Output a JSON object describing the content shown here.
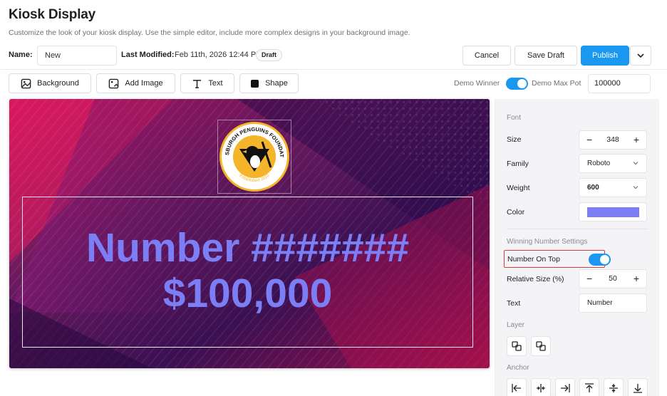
{
  "page": {
    "title": "Kiosk Display",
    "subtitle": "Customize the look of your kiosk display. Use the simple editor, include more complex designs in your background image."
  },
  "meta": {
    "name_label": "Name:",
    "name_value": "New",
    "last_modified_label": "Last Modified:",
    "last_modified_value": "Feb 11th, 2026 12:44 PM",
    "status_badge": "Draft"
  },
  "actions": {
    "cancel": "Cancel",
    "save_draft": "Save Draft",
    "publish": "Publish"
  },
  "toolbar": {
    "background": "Background",
    "add_image": "Add Image",
    "text": "Text",
    "shape": "Shape",
    "demo_winner_label": "Demo Winner",
    "demo_winner_on": true,
    "demo_max_pot_label": "Demo Max Pot",
    "demo_max_pot_value": "100000"
  },
  "canvas": {
    "logo_top_text": "PITTSBURGH PENGUINS FOUNDATION",
    "logo_bottom_text": "Established 2010",
    "line1": "Number #######",
    "line2": "$100,000",
    "text_color": "#7b7ef5"
  },
  "panel": {
    "font_header": "Font",
    "size_label": "Size",
    "size_value": "348",
    "family_label": "Family",
    "family_value": "Roboto",
    "weight_label": "Weight",
    "weight_value": "600",
    "color_label": "Color",
    "color_value": "#7b7ef5",
    "winning_header": "Winning Number Settings",
    "number_on_top_label": "Number On Top",
    "number_on_top_on": true,
    "relative_size_label": "Relative Size (%)",
    "relative_size_value": "50",
    "text_label": "Text",
    "text_value": "Number",
    "layer_header": "Layer",
    "anchor_header": "Anchor",
    "minus": "−",
    "plus": "+"
  },
  "colors": {
    "accent": "#1a97f0",
    "highlight": "#d93a3a"
  }
}
